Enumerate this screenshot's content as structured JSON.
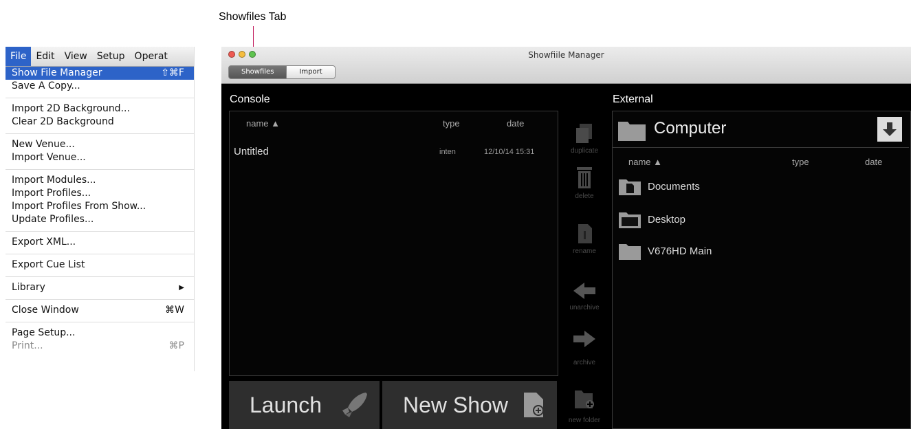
{
  "callout": {
    "label": "Showfiles Tab"
  },
  "menubar": [
    "File",
    "Edit",
    "View",
    "Setup",
    "Operat"
  ],
  "menu": {
    "items": [
      {
        "label": "Show File Manager",
        "shortcut": "⇧⌘F"
      },
      {
        "label": "Save A Copy..."
      },
      {
        "label": "Import 2D Background..."
      },
      {
        "label": "Clear 2D Background"
      },
      {
        "label": "New Venue..."
      },
      {
        "label": "Import Venue..."
      },
      {
        "label": "Import Modules..."
      },
      {
        "label": "Import Profiles..."
      },
      {
        "label": "Import Profiles From Show..."
      },
      {
        "label": "Update Profiles..."
      },
      {
        "label": "Export XML..."
      },
      {
        "label": "Export Cue List"
      },
      {
        "label": "Library",
        "shortcut": "▶"
      },
      {
        "label": "Close Window",
        "shortcut": "⌘W"
      },
      {
        "label": "Page Setup..."
      },
      {
        "label": "Print...",
        "shortcut": "⌘P"
      }
    ]
  },
  "window": {
    "title": "Showfiile Manager",
    "tabs": [
      "Showfiles",
      "Import"
    ]
  },
  "console": {
    "label": "Console",
    "columns": {
      "name": "name",
      "type": "type",
      "date": "date"
    },
    "rows": [
      {
        "name": "Untitled",
        "type": "inten",
        "date": "12/10/14 15:31"
      }
    ]
  },
  "tools": {
    "duplicate": "duplicate",
    "delete": "delete",
    "rename": "rename",
    "unarchive": "unarchive",
    "archive": "archive",
    "new_folder": "new folder"
  },
  "external": {
    "label": "External",
    "location": "Computer",
    "columns": {
      "name": "name",
      "type": "type",
      "date": "date"
    },
    "items": [
      "Documents",
      "Desktop",
      "V676HD Main"
    ]
  },
  "buttons": {
    "launch": "Launch",
    "new_show": "New Show"
  },
  "colors": {
    "menu_highlight": "#2d63c8",
    "window_bg": "#000000",
    "button_bg": "#2e2e2e",
    "callout_line": "#c2185b"
  }
}
